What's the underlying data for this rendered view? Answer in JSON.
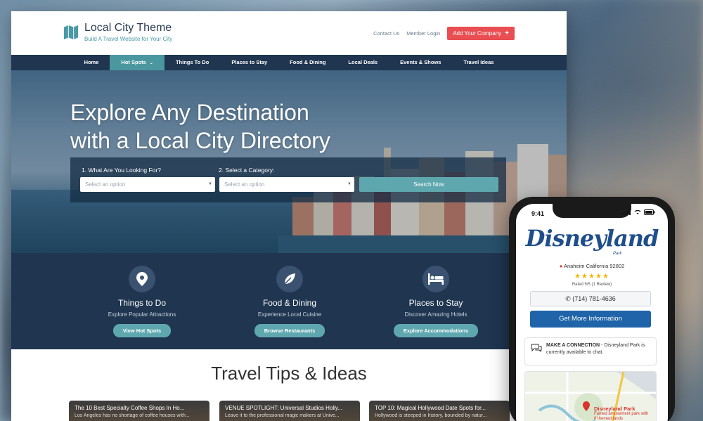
{
  "header": {
    "logo_title": "Local City Theme",
    "logo_tagline": "Build A Travel Website for Your City",
    "links": [
      "Contact Us",
      "Member Login"
    ],
    "cta": "Add Your Company"
  },
  "nav": {
    "items": [
      "Home",
      "Hot Spots",
      "Things To Do",
      "Places to Stay",
      "Food & Dining",
      "Local Deals",
      "Events & Shows",
      "Travel Ideas"
    ],
    "active": "Hot Spots"
  },
  "hero": {
    "title_line1": "Explore Any Destination",
    "title_line2": "with a Local City Directory",
    "label1": "1. What Are You Looking For?",
    "label2": "2. Select a Category:",
    "select1_placeholder": "Select an option",
    "select2_placeholder": "Select an option",
    "search_button": "Search Now"
  },
  "features": [
    {
      "icon": "map-pin-icon",
      "title": "Things to Do",
      "subtitle": "Explore Popular Attractions",
      "button": "View Hot Spots"
    },
    {
      "icon": "leaf-icon",
      "title": "Food & Dining",
      "subtitle": "Experience Local Cuisine",
      "button": "Browse Restaurants"
    },
    {
      "icon": "bed-icon",
      "title": "Places to Stay",
      "subtitle": "Discover Amazing Hotels",
      "button": "Explore Accommodations"
    }
  ],
  "tips": {
    "title": "Travel Tips & Ideas",
    "cards": [
      {
        "title": "The 10 Best Specialty Coffee Shops In Ho...",
        "text": "Los Angeles has no shortage of coffee houses with..."
      },
      {
        "title": "VENUE SPOTLIGHT: Universal Studios Holly...",
        "text": "Leave it to the professional magic makers at Unive..."
      },
      {
        "title": "TOP 10: Magical Hollywood Date Spots for...",
        "text": "Hollywood is steeped in history, bounded by natur..."
      }
    ]
  },
  "phone": {
    "time": "9:41",
    "listing_name": "Disneyland",
    "listing_sub": "Park",
    "address": "Anaheim California 92802",
    "rating_stars": 5,
    "rating_text": "Rated 5/5 (1 Review)",
    "phone_number": "(714) 781-4636",
    "info_button": "Get More Information",
    "connect_label": "MAKE A CONNECTION",
    "connect_text": "Disneyland Park is currently available to chat.",
    "map_label": "Disneyland Park",
    "map_sub": "Famed amusement park with 8 themed lands"
  },
  "colors": {
    "navy": "#1f3550",
    "teal": "#5fa7ae",
    "red_cta": "#e94e52",
    "phone_blue": "#1f64a8"
  }
}
